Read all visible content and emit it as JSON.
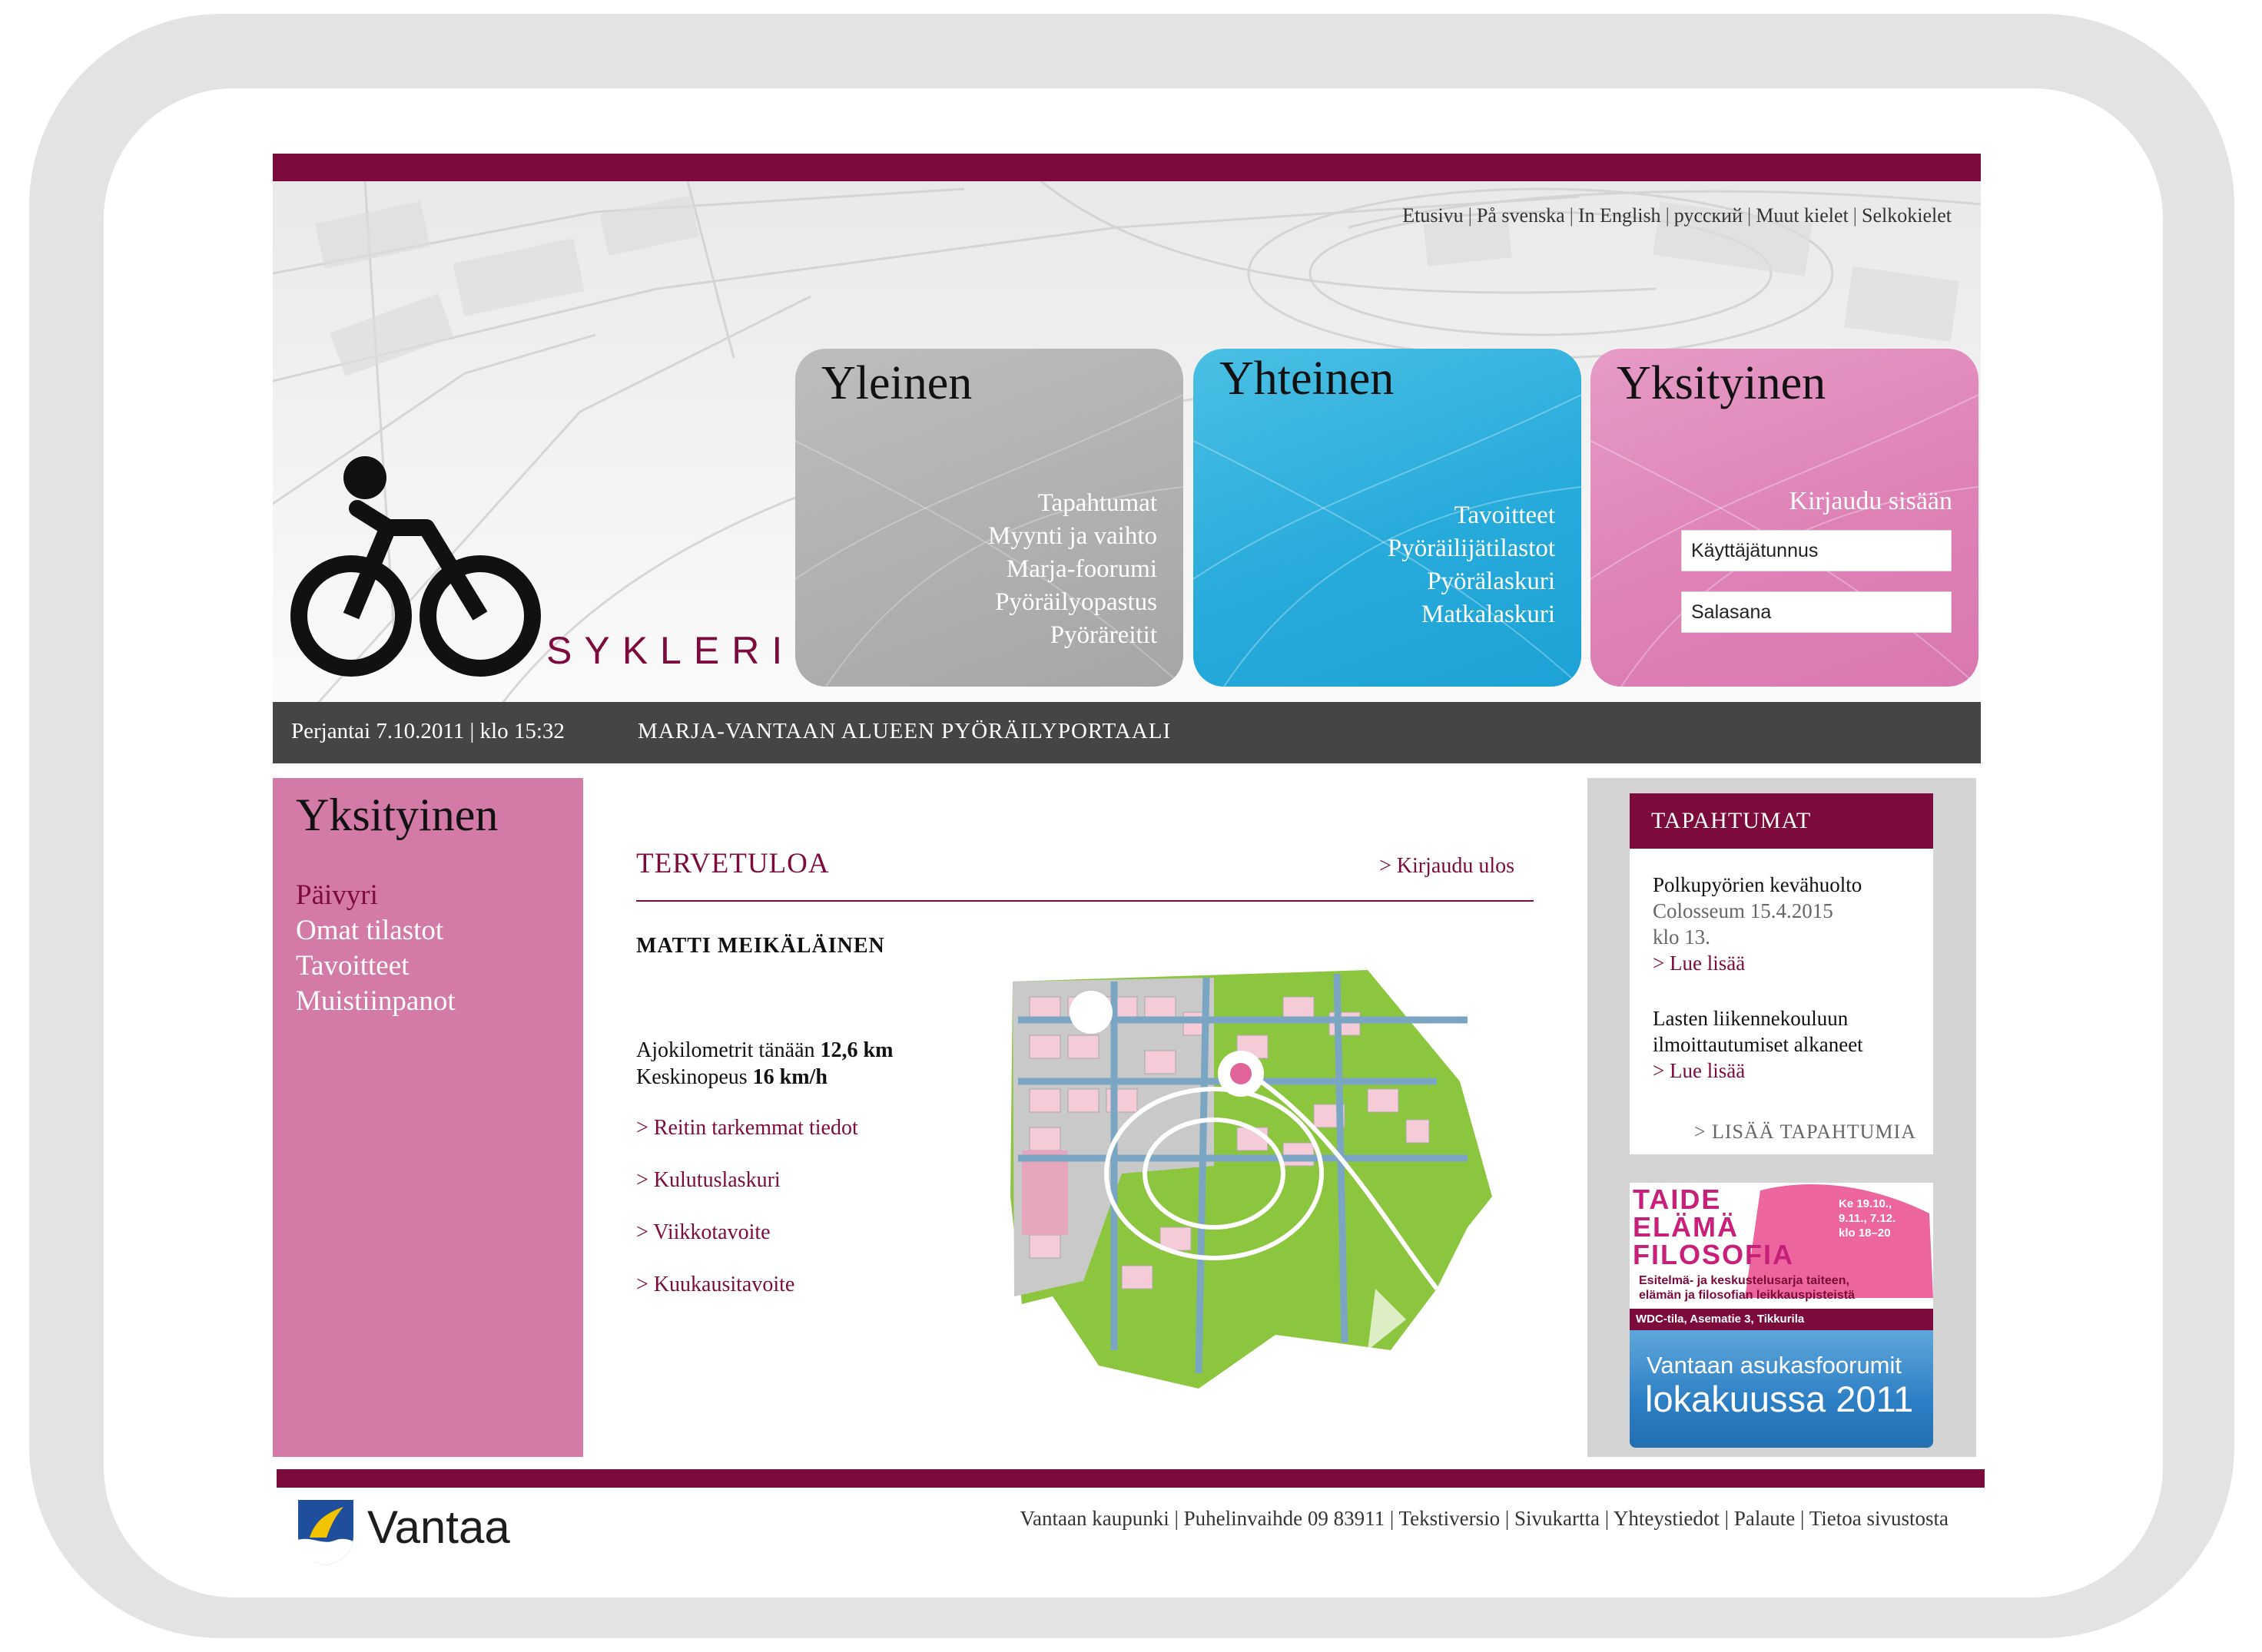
{
  "header": {
    "lang_links": [
      "Etusivu",
      "På svenska",
      "In English",
      "русский",
      "Muut kielet",
      "Selkokielet"
    ],
    "logo_text": "SYKLERI"
  },
  "cards": {
    "general": {
      "title": "Yleinen",
      "links": [
        "Tapahtumat",
        "Myynti ja vaihto",
        "Marja-foorumi",
        "Pyöräilyopastus",
        "Pyöräreitit"
      ]
    },
    "common": {
      "title": "Yhteinen",
      "links": [
        "Tavoitteet",
        "Pyöräilijätilastot",
        "Pyörälaskuri",
        "Matkalaskuri"
      ]
    },
    "private": {
      "title": "Yksityinen",
      "login_label": "Kirjaudu sisään",
      "username_placeholder": "Käyttäjätunnus",
      "password_placeholder": "Salasana"
    }
  },
  "infobar": {
    "date": "Perjantai 7.10.2011 | klo 15:32",
    "title": "MARJA-VANTAAN ALUEEN PYÖRÄILYPORTAALI"
  },
  "sidebar": {
    "title": "Yksityinen",
    "items": [
      "Päivyri",
      "Omat tilastot",
      "Tavoitteet",
      "Muistiinpanot"
    ]
  },
  "main": {
    "welcome": "TERVETULOA",
    "logout": "> Kirjaudu ulos",
    "user_name": "MATTI MEIKÄLÄINEN",
    "km_label": "Ajokilometrit tänään",
    "km_value": "12,6 km",
    "speed_label": "Keskinopeus",
    "speed_value": "16 km/h",
    "links": [
      "> Reitin tarkemmat tiedot",
      "> Kulutuslaskuri",
      "> Viikkotavoite",
      "> Kuukausitavoite"
    ]
  },
  "events": {
    "header": "TAPAHTUMAT",
    "items": [
      {
        "title": "Polkupyörien kevähuolto",
        "detail1": "Colosseum 15.4.2015",
        "detail2": "klo 13.",
        "more": "> Lue lisää"
      },
      {
        "title": "Lasten liikennekouluun",
        "detail1": "ilmoittautumiset alkaneet",
        "more": "> Lue lisää"
      }
    ],
    "more_events": "> LISÄÄ TAPAHTUMIA"
  },
  "ads": {
    "ad1": {
      "title_lines": [
        "TAIDE",
        "ELÄMÄ",
        "FILOSOFIA"
      ],
      "dates": [
        "Ke 19.10.,",
        "9.11., 7.12.",
        "klo 18–20"
      ],
      "desc": [
        "Esitelmä- ja keskustelusarja taiteen,",
        "elämän ja filosofian leikkauspisteistä"
      ],
      "venue": "WDC-tila, Asematie 3, Tikkurila"
    },
    "ad2": {
      "line1": "Vantaan asukasfoorumit",
      "line2": "lokakuussa 2011"
    }
  },
  "footer": {
    "brand": "Vantaa",
    "links": [
      "Vantaan kaupunki",
      "Puhelinvaihde 09 83911",
      "Tekstiversio",
      "Sivukartta",
      "Yhteystiedot",
      "Palaute",
      "Tietoa sivustosta"
    ]
  },
  "colors": {
    "brand": "#7c0a3d",
    "gray_card": "#b0b0b0",
    "blue_card": "#27abdb",
    "pink_card": "#de82b6",
    "sidebar": "#d47aa6",
    "dark_bar": "#454545",
    "map_green": "#8cc63f"
  }
}
